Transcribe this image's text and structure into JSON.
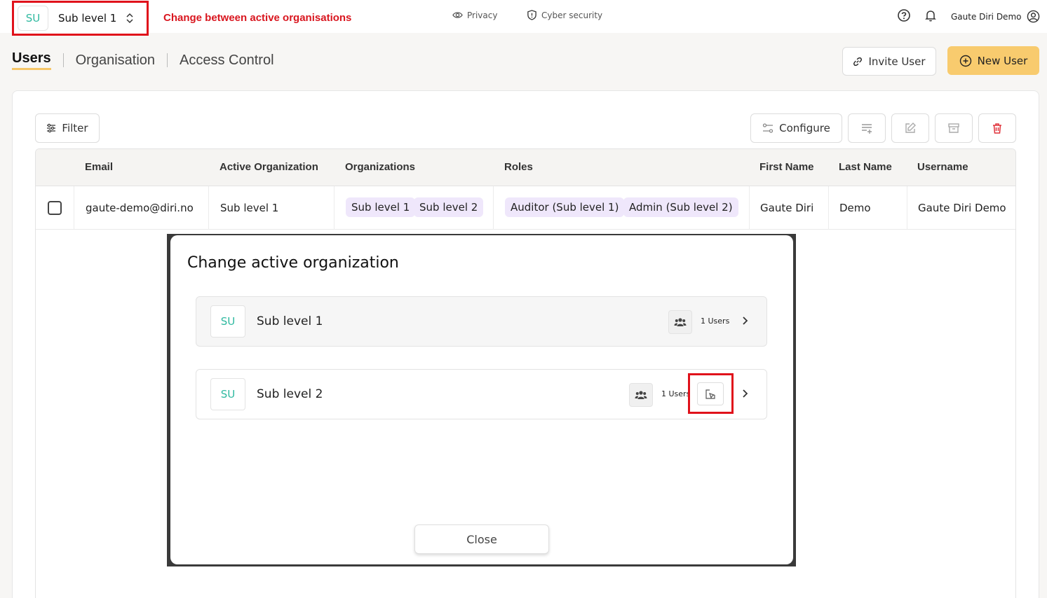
{
  "topbar": {
    "org_switcher": {
      "initials": "SU",
      "name": "Sub level 1"
    },
    "annotation": "Change between active organisations",
    "privacy_label": "Privacy",
    "cyber_label": "Cyber security",
    "user_name": "Gaute Diri Demo"
  },
  "tabs": [
    "Users",
    "Organisation",
    "Access Control"
  ],
  "actions": {
    "invite": "Invite User",
    "new_user": "New User"
  },
  "toolbar": {
    "filter": "Filter",
    "configure": "Configure"
  },
  "table": {
    "headers": [
      "Email",
      "Active Organization",
      "Organizations",
      "Roles",
      "First Name",
      "Last Name",
      "Username"
    ],
    "rows": [
      {
        "email": "gaute-demo@diri.no",
        "active_org": "Sub level 1",
        "orgs": [
          "Sub level 1",
          "Sub level 2"
        ],
        "roles": [
          "Auditor (Sub level 1)",
          "Admin (Sub level 2)"
        ],
        "first_name": "Gaute Diri",
        "last_name": "Demo",
        "username": "Gaute Diri Demo"
      }
    ]
  },
  "modal": {
    "title": "Change active organization",
    "orgs": [
      {
        "initials": "SU",
        "name": "Sub level 1",
        "users": "1 Users"
      },
      {
        "initials": "SU",
        "name": "Sub level 2",
        "users": "1 Users"
      }
    ],
    "close": "Close"
  },
  "colors": {
    "accent": "#f8cb6e",
    "highlight": "#e0121b",
    "teal": "#2fb9a0",
    "chip": "#efe7fb"
  }
}
